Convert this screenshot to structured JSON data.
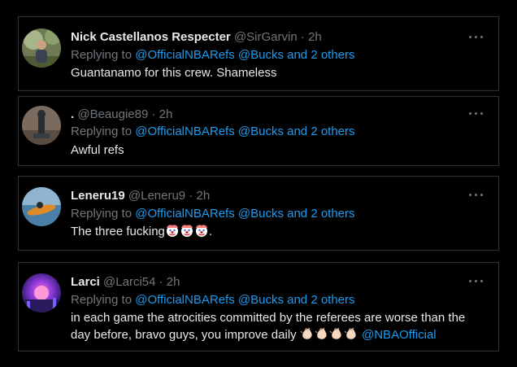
{
  "tweets": [
    {
      "name": "Nick Castellanos Respecter",
      "handle": "@SirGarvin",
      "time": "· 2h",
      "replying_prefix": "Replying to",
      "reply_mentions": [
        "@OfficialNBARefs",
        "@Bucks"
      ],
      "reply_others": "and 2 others",
      "text": "Guantanamo for this crew. Shameless",
      "avatar_icon": "profile-photo-man-outdoors"
    },
    {
      "name": ".",
      "handle": "@Beaugie89",
      "time": "· 2h",
      "replying_prefix": "Replying to",
      "reply_mentions": [
        "@OfficialNBARefs",
        "@Bucks"
      ],
      "reply_others": "and 2 others",
      "text": "Awful refs",
      "avatar_icon": "profile-photo-statue"
    },
    {
      "name": "Leneru19",
      "handle": "@Leneru9",
      "time": "· 2h",
      "replying_prefix": "Replying to",
      "reply_mentions": [
        "@OfficialNBARefs",
        "@Bucks"
      ],
      "reply_others": "and 2 others",
      "text": "The three fucking",
      "text_suffix": ".",
      "emojis": [
        "clown-face",
        "clown-face",
        "clown-face"
      ],
      "avatar_icon": "profile-photo-kayak"
    },
    {
      "name": "Larci",
      "handle": "@Larci54",
      "time": "· 2h",
      "replying_prefix": "Replying to",
      "reply_mentions": [
        "@OfficialNBARefs",
        "@Bucks"
      ],
      "reply_others": "and 2 others",
      "text_line1": "in each game the atrocities committed by the referees are worse than the",
      "text_line2": "day before, bravo guys, you improve daily",
      "emojis": [
        "clapping-hands",
        "clapping-hands",
        "clapping-hands",
        "clapping-hands"
      ],
      "trailing_mention": "@NBAOfficial",
      "avatar_icon": "profile-photo-neon-sunset"
    }
  ],
  "more_icon": "more-options-icon",
  "colors": {
    "background": "#000000",
    "text": "#e7e9ea",
    "muted": "#71767b",
    "link": "#1d9bf0",
    "border": "#2f3336"
  }
}
